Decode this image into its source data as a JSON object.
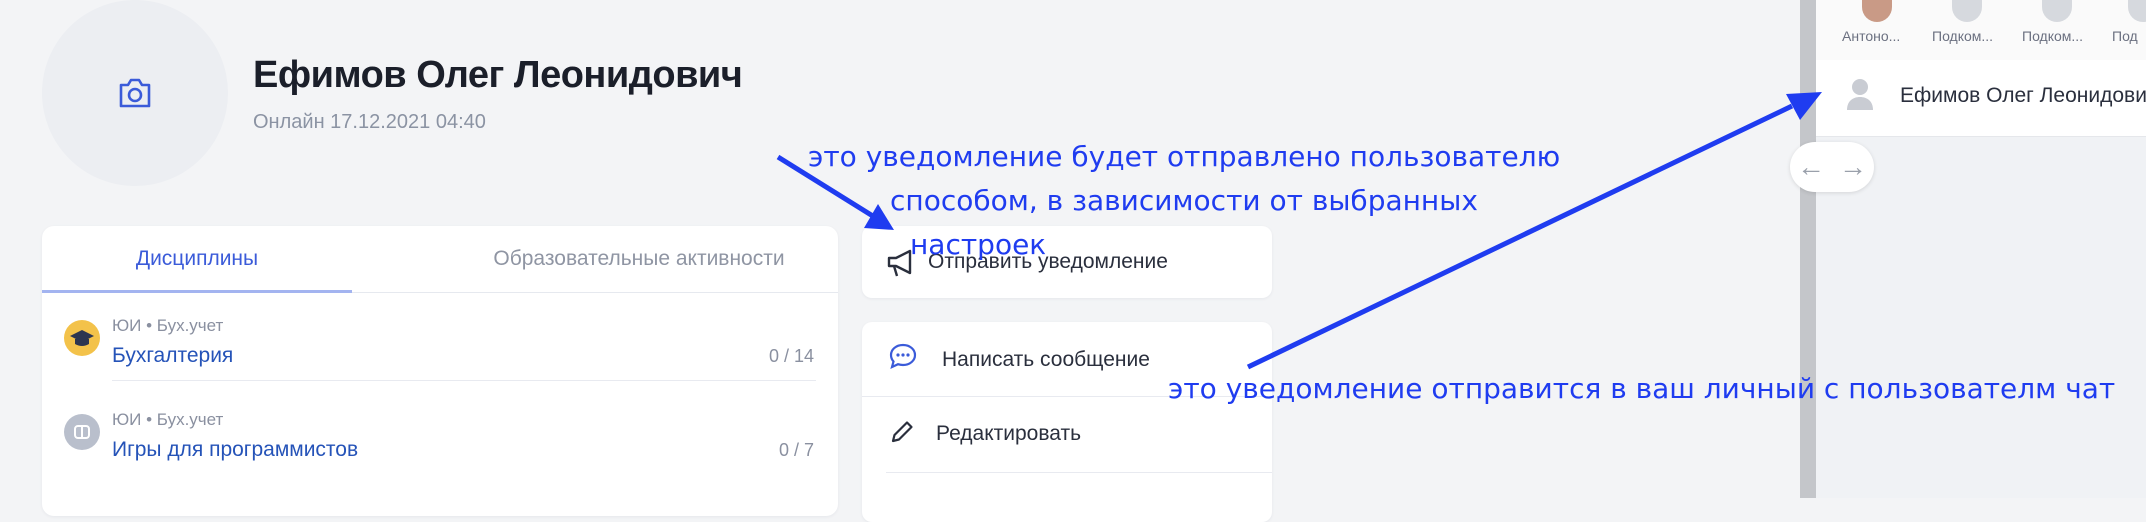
{
  "profile": {
    "name": "Ефимов Олег Леонидович",
    "status": "Онлайн 17.12.2021 04:40"
  },
  "tabs": [
    "Дисциплины",
    "Образовательные активности"
  ],
  "courses": [
    {
      "meta": "ЮИ  •  Бух.учет",
      "title": "Бухгалтерия",
      "count": "0 / 14"
    },
    {
      "meta": "ЮИ  •  Бух.учет",
      "title": "Игры для программистов",
      "count": "0 / 7"
    }
  ],
  "actions": {
    "notify": "Отправить уведомление",
    "message": "Написать сообщение",
    "edit": "Редактировать"
  },
  "chat_panel": {
    "participants": [
      "Антоно...",
      "Подком...",
      "Подком...",
      "Под"
    ],
    "user_name": "Ефимов Олег Леонидович"
  },
  "annotations": {
    "notify_line1": "это уведомление будет отправлено пользователю",
    "notify_line2": "способом, в зависимости от выбранных",
    "notify_line3": "настроек",
    "chat_note": "это уведомление отправится в ваш личный с пользователм чат"
  },
  "colors": {
    "accent": "#3b5bd9",
    "annotation": "#1f3cf0"
  }
}
